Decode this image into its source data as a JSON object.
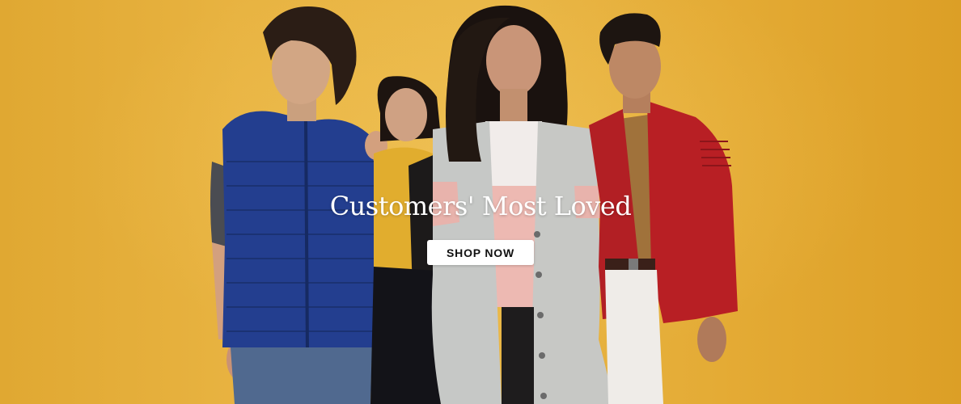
{
  "banner": {
    "headline": "Customers' Most Loved",
    "cta_label": "SHOP NOW",
    "background_color": "#e8b341",
    "icons": [
      "hero-photo"
    ]
  }
}
